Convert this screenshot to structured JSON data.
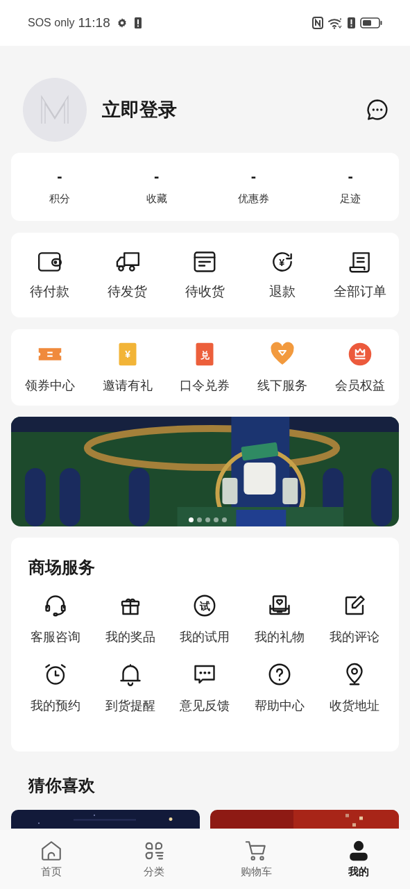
{
  "status_bar": {
    "carrier": "SOS only",
    "time": "11:18"
  },
  "profile": {
    "login": "立即登录"
  },
  "stats": [
    {
      "value": "-",
      "label": "积分"
    },
    {
      "value": "-",
      "label": "收藏"
    },
    {
      "value": "-",
      "label": "优惠券"
    },
    {
      "value": "-",
      "label": "足迹"
    }
  ],
  "orders": [
    {
      "label": "待付款"
    },
    {
      "label": "待发货"
    },
    {
      "label": "待收货"
    },
    {
      "label": "退款",
      "icon_text": "¥"
    },
    {
      "label": "全部订单"
    }
  ],
  "perks": [
    {
      "label": "领券中心",
      "color": "#f08a3c"
    },
    {
      "label": "邀请有礼",
      "color": "#f2b437",
      "icon_text": "¥"
    },
    {
      "label": "口令兑券",
      "color": "#ec5f3b",
      "icon_text": "兑"
    },
    {
      "label": "线下服务",
      "color": "#f29a3e"
    },
    {
      "label": "会员权益",
      "color": "#ec5a3c"
    }
  ],
  "banner": {
    "kind": "picture",
    "dots": [
      {
        "selected": true
      },
      {
        "selected": false
      },
      {
        "selected": false
      },
      {
        "selected": false
      },
      {
        "selected": false
      }
    ]
  },
  "mall_services": {
    "title": "商场服务",
    "items": [
      {
        "label": "客服咨询"
      },
      {
        "label": "我的奖品"
      },
      {
        "label": "我的试用",
        "icon_text": "试"
      },
      {
        "label": "我的礼物"
      },
      {
        "label": "我的评论"
      },
      {
        "label": "我的预约"
      },
      {
        "label": "到货提醒"
      },
      {
        "label": "意见反馈"
      },
      {
        "label": "帮助中心"
      },
      {
        "label": "收货地址"
      }
    ]
  },
  "recommend": {
    "title": "猜你喜欢"
  },
  "tab_bar": [
    {
      "label": "首页",
      "selected": false
    },
    {
      "label": "分类",
      "selected": false
    },
    {
      "label": "购物车",
      "selected": false
    },
    {
      "label": "我的",
      "selected": true
    }
  ]
}
